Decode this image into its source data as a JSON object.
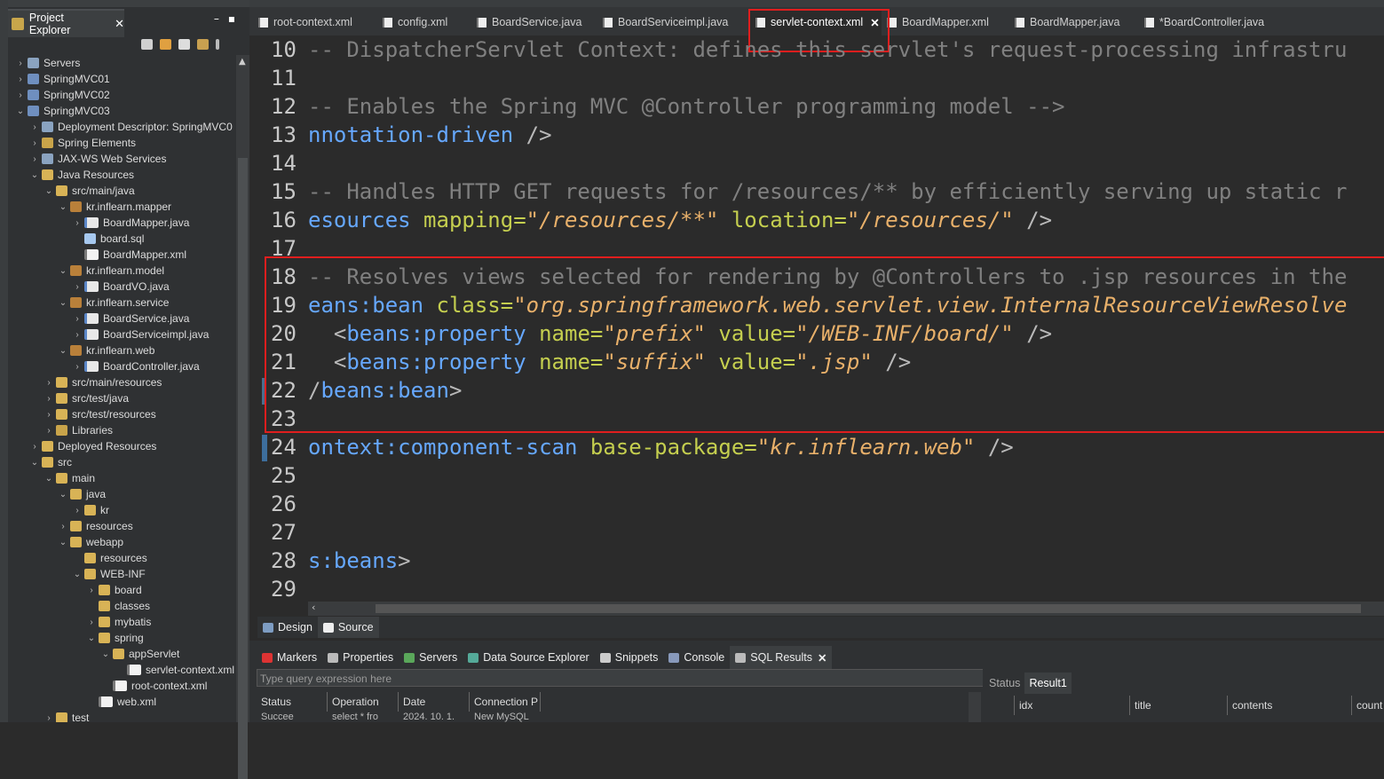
{
  "explorer": {
    "tab_label": "Project Explorer",
    "close": "✕",
    "items": [
      {
        "label": "Servers",
        "arrow": "›",
        "icon": "srv"
      },
      {
        "label": "SpringMVC01",
        "arrow": "›",
        "icon": "proj"
      },
      {
        "label": "SpringMVC02",
        "arrow": "›",
        "icon": "proj"
      },
      {
        "label": "SpringMVC03",
        "arrow": "⌄",
        "icon": "proj"
      },
      {
        "label": "Deployment Descriptor: SpringMVC0",
        "arrow": "›",
        "icon": "srv"
      },
      {
        "label": "Spring Elements",
        "arrow": "›",
        "icon": "lib"
      },
      {
        "label": "JAX-WS Web Services",
        "arrow": "›",
        "icon": "srv"
      },
      {
        "label": "Java Resources",
        "arrow": "⌄",
        "icon": "folder"
      },
      {
        "label": "src/main/java",
        "arrow": "⌄",
        "icon": "folder"
      },
      {
        "label": "kr.inflearn.mapper",
        "arrow": "⌄",
        "icon": "pkg"
      },
      {
        "label": "BoardMapper.java",
        "arrow": "›",
        "icon": "java"
      },
      {
        "label": "board.sql",
        "arrow": "",
        "icon": "sql"
      },
      {
        "label": "BoardMapper.xml",
        "arrow": "",
        "icon": "xml"
      },
      {
        "label": "kr.inflearn.model",
        "arrow": "⌄",
        "icon": "pkg"
      },
      {
        "label": "BoardVO.java",
        "arrow": "›",
        "icon": "java"
      },
      {
        "label": "kr.inflearn.service",
        "arrow": "⌄",
        "icon": "pkg"
      },
      {
        "label": "BoardService.java",
        "arrow": "›",
        "icon": "java"
      },
      {
        "label": "BoardServiceimpl.java",
        "arrow": "›",
        "icon": "java"
      },
      {
        "label": "kr.inflearn.web",
        "arrow": "⌄",
        "icon": "pkg"
      },
      {
        "label": "BoardController.java",
        "arrow": "›",
        "icon": "java"
      },
      {
        "label": "src/main/resources",
        "arrow": "›",
        "icon": "folder"
      },
      {
        "label": "src/test/java",
        "arrow": "›",
        "icon": "folder"
      },
      {
        "label": "src/test/resources",
        "arrow": "›",
        "icon": "folder"
      },
      {
        "label": "Libraries",
        "arrow": "›",
        "icon": "lib"
      },
      {
        "label": "Deployed Resources",
        "arrow": "›",
        "icon": "folder"
      },
      {
        "label": "src",
        "arrow": "⌄",
        "icon": "folder"
      },
      {
        "label": "main",
        "arrow": "⌄",
        "icon": "folder"
      },
      {
        "label": "java",
        "arrow": "⌄",
        "icon": "folder"
      },
      {
        "label": "kr",
        "arrow": "›",
        "icon": "folder"
      },
      {
        "label": "resources",
        "arrow": "›",
        "icon": "folder"
      },
      {
        "label": "webapp",
        "arrow": "⌄",
        "icon": "folder"
      },
      {
        "label": "resources",
        "arrow": "",
        "icon": "folder"
      },
      {
        "label": "WEB-INF",
        "arrow": "⌄",
        "icon": "folder"
      },
      {
        "label": "board",
        "arrow": "›",
        "icon": "folder"
      },
      {
        "label": "classes",
        "arrow": "",
        "icon": "folder"
      },
      {
        "label": "mybatis",
        "arrow": "›",
        "icon": "folder"
      },
      {
        "label": "spring",
        "arrow": "⌄",
        "icon": "folder"
      },
      {
        "label": "appServlet",
        "arrow": "⌄",
        "icon": "folder"
      },
      {
        "label": "servlet-context.xml",
        "arrow": "",
        "icon": "xml"
      },
      {
        "label": "root-context.xml",
        "arrow": "",
        "icon": "xml"
      },
      {
        "label": "web.xml",
        "arrow": "",
        "icon": "xml"
      },
      {
        "label": "test",
        "arrow": "›",
        "icon": "folder"
      }
    ]
  },
  "editor": {
    "tabs": [
      {
        "label": "root-context.xml"
      },
      {
        "label": "config.xml"
      },
      {
        "label": "BoardService.java"
      },
      {
        "label": "BoardServiceimpl.java"
      },
      {
        "label": "servlet-context.xml",
        "active": true
      },
      {
        "label": "BoardMapper.xml"
      },
      {
        "label": "BoardMapper.java"
      },
      {
        "label": "*BoardController.java"
      }
    ],
    "close": "✕",
    "line_numbers": [
      "10",
      "11",
      "12",
      "13",
      "14",
      "15",
      "16",
      "17",
      "18",
      "19",
      "20",
      "21",
      "22",
      "23",
      "24",
      "25",
      "26",
      "27",
      "28",
      "29"
    ],
    "lines": {
      "l10_comment": "-- DispatcherServlet Context: defines this servlet's request-processing infrastru",
      "l12_comment": "-- Enables the Spring MVC @Controller programming model -->",
      "l13_tag": "nnotation-driven",
      "l13_end": " />",
      "l15_comment": "-- Handles HTTP GET requests for /resources/** by efficiently serving up static r",
      "l16_tag": "esources",
      "l16_attr1": " mapping=",
      "l16_val1": "\"/resources/**\"",
      "l16_attr2": " location=",
      "l16_val2": "\"/resources/\"",
      "l16_end": " />",
      "l18_comment": "-- Resolves views selected for rendering by @Controllers to .jsp resources in the",
      "l19_tag": "eans:bean",
      "l19_attr": " class=",
      "l19_val": "\"org.springframework.web.servlet.view.InternalResourceViewResolve",
      "l20_open": "  <",
      "l20_tag": "beans:property",
      "l20_attr1": " name=",
      "l20_val1": "\"prefix\"",
      "l20_attr2": " value=",
      "l20_val2": "\"/WEB-INF/board/\"",
      "l20_end": " />",
      "l21_open": "  <",
      "l21_tag": "beans:property",
      "l21_attr1": " name=",
      "l21_val1": "\"suffix\"",
      "l21_attr2": " value=",
      "l21_val2": "\".jsp\"",
      "l21_end": " />",
      "l22_open": "/",
      "l22_tag": "beans:bean",
      "l22_end": ">",
      "l24_tag": "ontext:component-scan",
      "l24_attr": " base-package=",
      "l24_val": "\"kr.inflearn.web\"",
      "l24_end": " />",
      "l28_tag": "s:beans",
      "l28_end": ">"
    },
    "design_tab": "Design",
    "source_tab": "Source"
  },
  "bottom": {
    "tabs": [
      "Markers",
      "Properties",
      "Servers",
      "Data Source Explorer",
      "Snippets",
      "Console",
      "SQL Results"
    ],
    "close": "✕",
    "query_placeholder": "Type query expression here",
    "columns": [
      "Status",
      "Operation",
      "Date",
      "Connection P"
    ],
    "row": [
      "Succee",
      "select * fro",
      "2024. 10. 1.",
      "New MySQL"
    ],
    "result_tabs": [
      "Status",
      "Result1"
    ],
    "result_columns": [
      "idx",
      "title",
      "contents",
      "count"
    ]
  },
  "colors": {
    "highlight_box": "#e01e1e",
    "tag": "#66a8ff",
    "attr": "#c5cf4f",
    "string": "#e8b06a",
    "comment": "#808080"
  }
}
